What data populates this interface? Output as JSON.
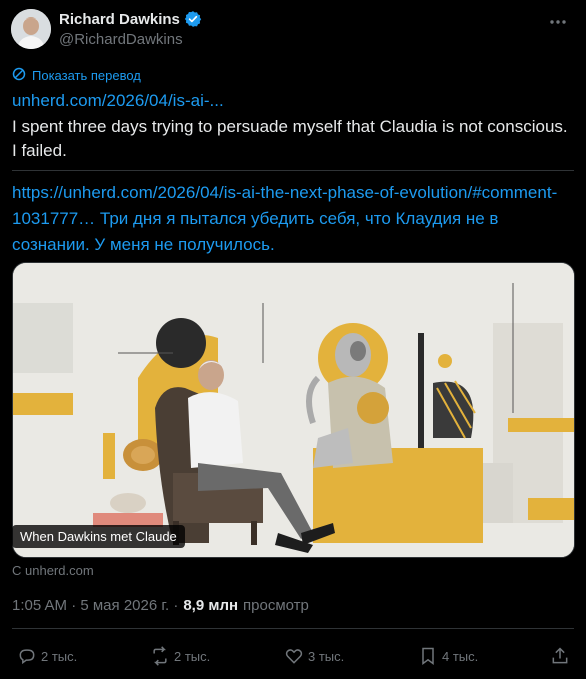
{
  "author": {
    "name": "Richard Dawkins",
    "handle": "@RichardDawkins"
  },
  "translate_label": "Показать перевод",
  "post": {
    "link_short": "unherd.com/2026/04/is-ai-...",
    "text_line": "I spent three days trying to persuade myself that Claudia is not conscious. I failed.",
    "long_text": "https://unherd.com/2026/04/is-ai-the-next-phase-of-evolution/#comment-1031777… Три дня я пытался убедить себя, что Клаудия не в сознании. У меня не получилось."
  },
  "media": {
    "caption": "When Dawkins met Claude",
    "source": "С unherd.com"
  },
  "meta": {
    "time": "1:05 AM · 5 мая 2026 г. ·",
    "views": "8,9 млн",
    "views_label": "просмотр"
  },
  "actions": {
    "replies": "2 тыс.",
    "reposts": "2 тыс.",
    "likes": "3 тыс.",
    "bookmarks": "4 тыс."
  },
  "colors": {
    "background": "#000000",
    "text": "#e7e9ea",
    "muted": "#71767b",
    "link": "#1d9bf0",
    "verified": "#1d9bf0"
  }
}
